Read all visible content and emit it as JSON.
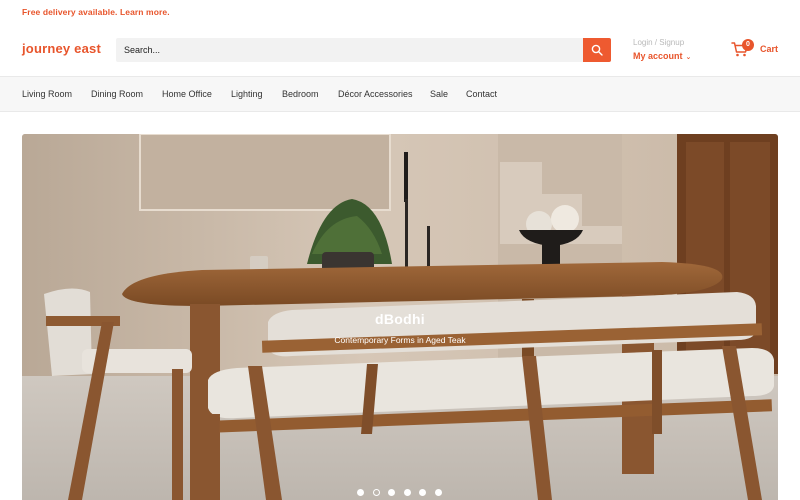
{
  "announcement": {
    "text": "Free delivery available. Learn more."
  },
  "header": {
    "logo": "journey east",
    "search": {
      "placeholder": "Search..."
    },
    "login_label": "Login / Signup",
    "account_label": "My account",
    "cart": {
      "count": "0",
      "label": "Cart"
    }
  },
  "nav": {
    "items": [
      {
        "label": "Living Room"
      },
      {
        "label": "Dining Room"
      },
      {
        "label": "Home Office"
      },
      {
        "label": "Lighting"
      },
      {
        "label": "Bedroom"
      },
      {
        "label": "Décor Accessories"
      },
      {
        "label": "Sale"
      },
      {
        "label": "Contact"
      }
    ]
  },
  "hero": {
    "title": "dBodhi",
    "subtitle": "Contemporary Forms in Aged Teak",
    "slides": {
      "count": 6,
      "active": 2
    }
  },
  "colors": {
    "accent": "#e8552c",
    "nav_bg": "#f7f7f7",
    "search_bg": "#f2f2f2"
  },
  "icons": {
    "search": "search-icon",
    "cart": "cart-icon",
    "account_chevron": "chevron-down-icon"
  }
}
